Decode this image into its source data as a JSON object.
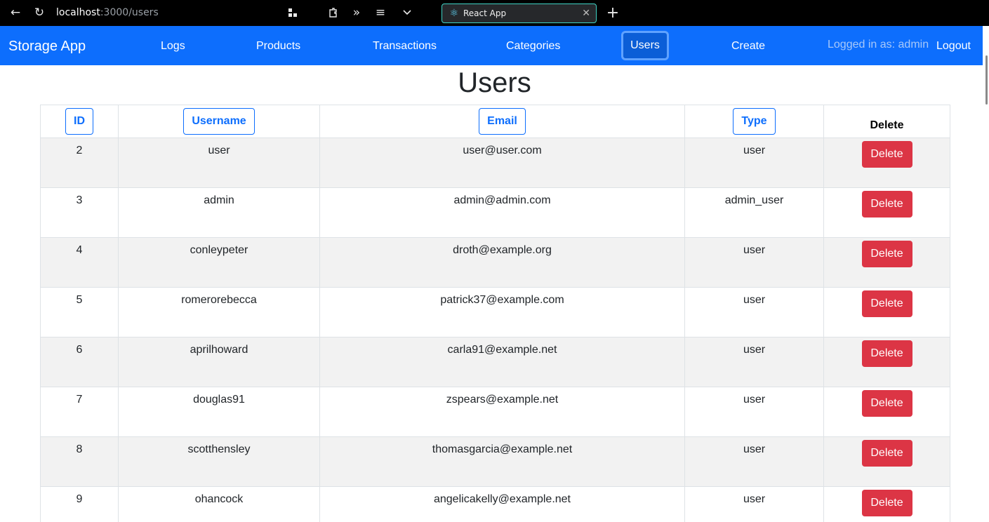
{
  "browser": {
    "url_host": "localhost",
    "url_path": ":3000/users",
    "tab_title": "React App",
    "tab_close": "✕",
    "new_tab": "+"
  },
  "navbar": {
    "brand": "Storage App",
    "links": [
      "Logs",
      "Products",
      "Transactions",
      "Categories",
      "Users",
      "Create"
    ],
    "active": "Users",
    "logged_in": "Logged in as: admin",
    "logout": "Logout",
    "bg_color": "#0d6efd"
  },
  "page": {
    "title": "Users"
  },
  "table": {
    "headers": {
      "id": "ID",
      "username": "Username",
      "email": "Email",
      "type": "Type",
      "delete": "Delete"
    },
    "delete_label": "Delete",
    "rows": [
      {
        "id": "2",
        "username": "user",
        "email": "user@user.com",
        "type": "user"
      },
      {
        "id": "3",
        "username": "admin",
        "email": "admin@admin.com",
        "type": "admin_user"
      },
      {
        "id": "4",
        "username": "conleypeter",
        "email": "droth@example.org",
        "type": "user"
      },
      {
        "id": "5",
        "username": "romerorebecca",
        "email": "patrick37@example.com",
        "type": "user"
      },
      {
        "id": "6",
        "username": "aprilhoward",
        "email": "carla91@example.net",
        "type": "user"
      },
      {
        "id": "7",
        "username": "douglas91",
        "email": "zspears@example.net",
        "type": "user"
      },
      {
        "id": "8",
        "username": "scotthensley",
        "email": "thomasgarcia@example.net",
        "type": "user"
      },
      {
        "id": "9",
        "username": "ohancock",
        "email": "angelicakelly@example.net",
        "type": "user"
      }
    ]
  },
  "colors": {
    "primary": "#0d6efd",
    "danger": "#dc3545",
    "stripe": "#f2f2f2"
  }
}
